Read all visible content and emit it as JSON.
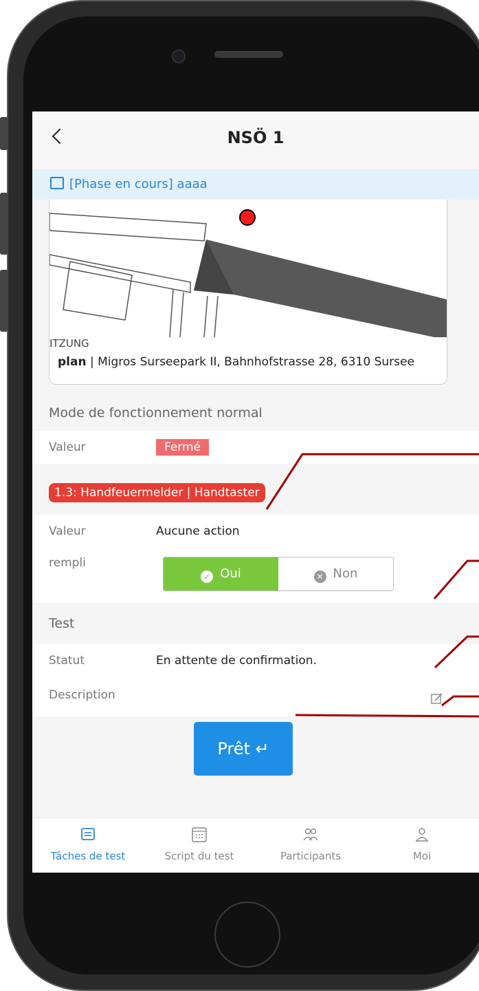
{
  "header": {
    "title": "NSÖ 1",
    "back_icon": "chevron-left-icon"
  },
  "phase_banner": {
    "text": "[Phase en cours] aaaa",
    "icon": "calendar-check-icon",
    "color": "#2a86d4"
  },
  "plan": {
    "overlay_text": "ITZUNG",
    "caption_bold": "plan",
    "caption_rest": " | Migros Surseepark II, Bahnhofstrasse 28, 6310 Sursee",
    "marker_color": "#ff0000"
  },
  "normal_mode": {
    "section_title": "Mode de fonctionnement normal",
    "value_label": "Valeur",
    "value": "Fermé",
    "value_color": "#f06c6c"
  },
  "device": {
    "badge": "1.3: Handfeuermelder | Handtaster",
    "value_label": "Valeur",
    "value": "Aucune action",
    "filled_label": "rempli",
    "yes_label": "Oui",
    "no_label": "Non",
    "selected": "Oui",
    "yes_color": "#79c83c"
  },
  "test": {
    "section_title": "Test",
    "status_label": "Statut",
    "status_value": "En attente de confirmation.",
    "description_label": "Description",
    "edit_icon": "edit-icon"
  },
  "ready_button": {
    "label": "Prêt ↵",
    "color": "#1f8fe6"
  },
  "tabs": [
    {
      "label": "Tâches de test",
      "icon": "list-icon",
      "active": true
    },
    {
      "label": "Script du test",
      "icon": "keypad-icon",
      "active": false
    },
    {
      "label": "Participants",
      "icon": "users-icon",
      "active": false
    },
    {
      "label": "Moi",
      "icon": "user-icon",
      "active": false
    }
  ]
}
